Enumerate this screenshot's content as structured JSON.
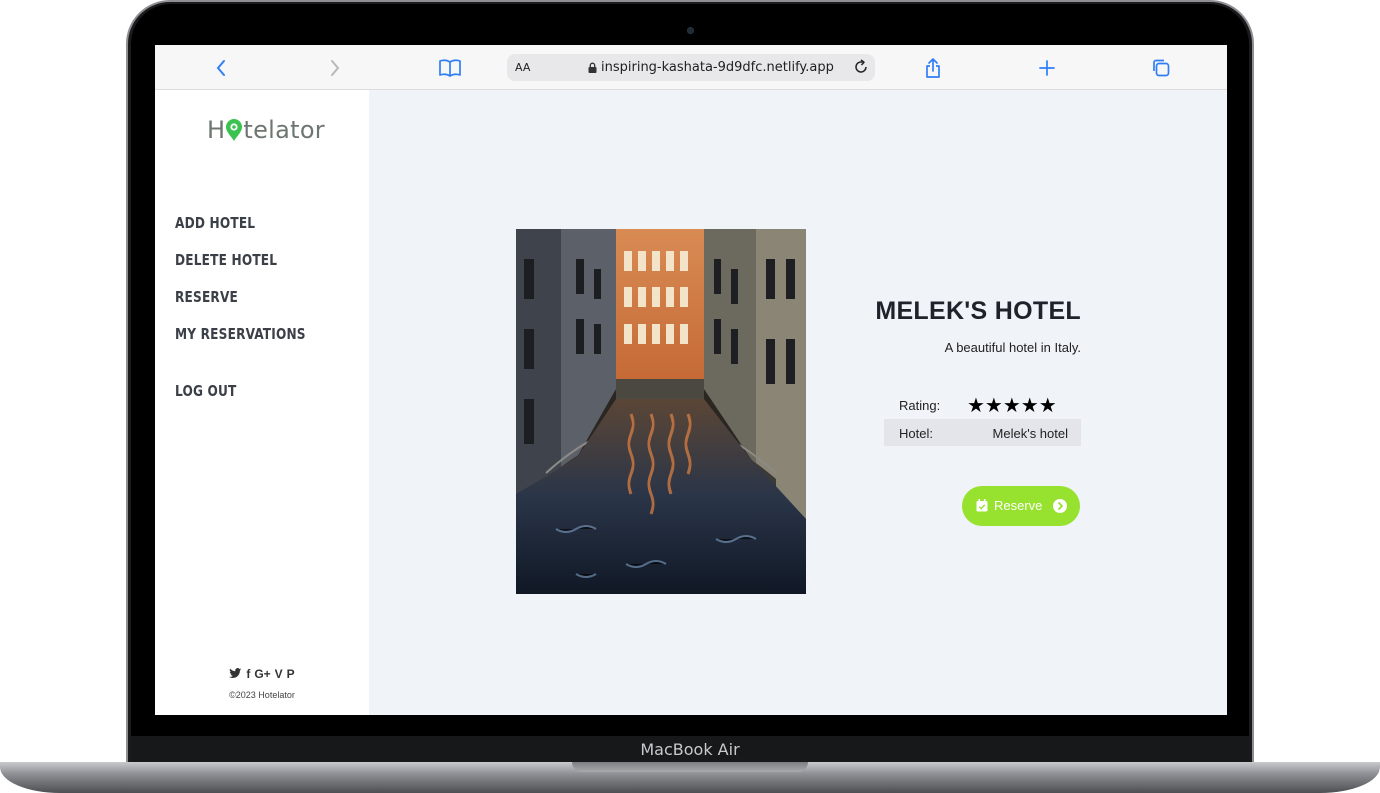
{
  "device": {
    "label": "MacBook Air"
  },
  "browser": {
    "url": "inspiring-kashata-9d9dfc.netlify.app",
    "text_size_label": "AA",
    "buttons": [
      "back-icon",
      "forward-icon",
      "bookmarks-icon",
      "reload-icon",
      "share-icon",
      "new-tab-icon",
      "tabs-icon"
    ]
  },
  "sidebar": {
    "brand": {
      "name_prefix": "H",
      "name_suffix": "telator"
    },
    "nav": {
      "add_hotel": "ADD HOTEL",
      "delete_hotel": "DELETE HOTEL",
      "reserve": "RESERVE",
      "my_reservations": "MY RESERVATIONS",
      "log_out": "LOG OUT"
    },
    "social_icons": [
      "twitter-icon",
      "facebook-icon",
      "google-plus-icon",
      "vimeo-icon",
      "pinterest-icon"
    ],
    "social": {
      "twitter": "🐦",
      "facebook": "f",
      "google": "G+",
      "vimeo": "V",
      "pinterest": "P"
    },
    "copyright": "©2023 Hotelator"
  },
  "hotel": {
    "title": "MELEK'S HOTEL",
    "description": "A beautiful hotel in Italy.",
    "rating_label": "Rating:",
    "rating": 5,
    "rating_max": 5,
    "stars": "★★★★★",
    "hotel_label": "Hotel:",
    "hotel_value": "Melek's hotel",
    "reserve_label": "Reserve"
  },
  "colors": {
    "accent": "#97e12f",
    "logo_pin": "#3cc24f",
    "content_bg": "#f0f3f8",
    "nav_text": "#3b4048"
  }
}
